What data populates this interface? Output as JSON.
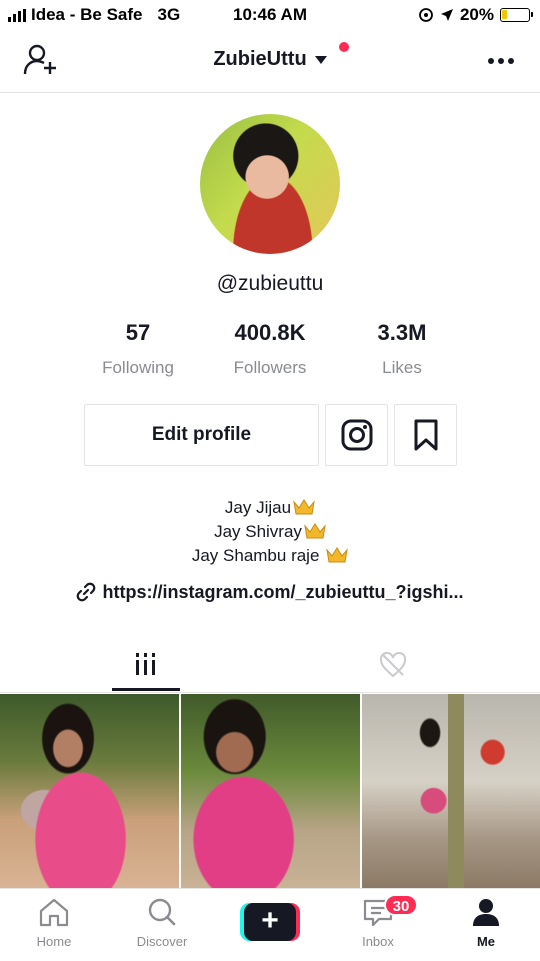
{
  "status_bar": {
    "carrier": "Idea - Be Safe",
    "network": "3G",
    "time": "10:46 AM",
    "battery": "20%",
    "battery_level": 0.2
  },
  "header": {
    "username": "ZubieUttu",
    "add_user_icon": "add-user-icon",
    "more_icon": "more-icon"
  },
  "profile": {
    "handle": "@zubieuttu",
    "stats": [
      {
        "value": "57",
        "label": "Following"
      },
      {
        "value": "400.8K",
        "label": "Followers"
      },
      {
        "value": "3.3M",
        "label": "Likes"
      }
    ],
    "edit_profile_label": "Edit profile",
    "bio_lines": [
      "Jay Jijau",
      "Jay Shivray",
      "Jay Shambu raje"
    ],
    "link": "https://instagram.com/_zubieuttu_?igshi..."
  },
  "tabs": [
    {
      "icon": "grid-icon",
      "active": true
    },
    {
      "icon": "liked-icon",
      "active": false
    }
  ],
  "nav": {
    "items": [
      {
        "label": "Home",
        "icon": "home-icon"
      },
      {
        "label": "Discover",
        "icon": "search-icon"
      },
      {
        "label": "Inbox",
        "icon": "inbox-icon",
        "badge": "30"
      },
      {
        "label": "Me",
        "icon": "profile-icon",
        "active": true
      }
    ]
  },
  "colors": {
    "accent": "#fe2c55",
    "secondary_accent": "#25f4ee",
    "text": "#161823",
    "muted": "#8a8b91"
  }
}
